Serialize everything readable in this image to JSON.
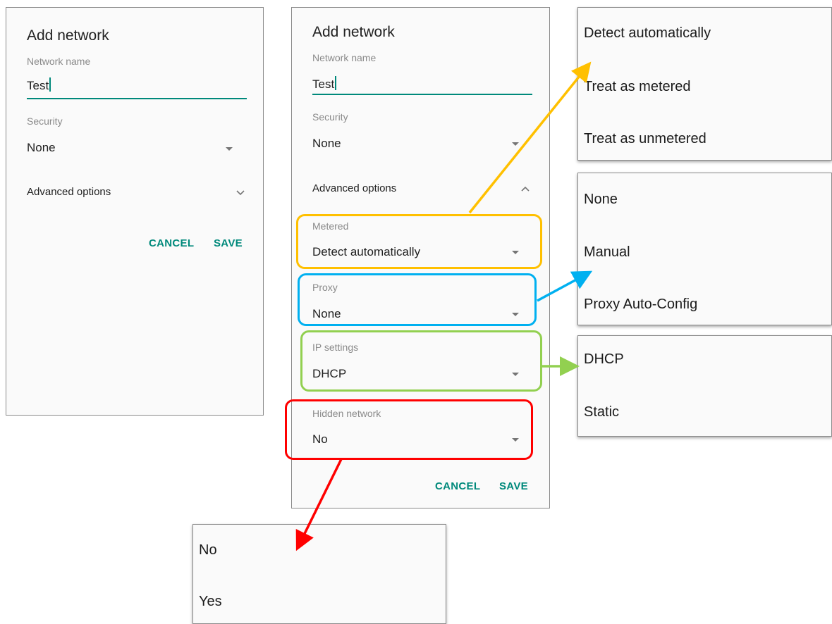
{
  "simple_dialog": {
    "title": "Add network",
    "network_name_label": "Network name",
    "network_name_value": "Test",
    "security_label": "Security",
    "security_value": "None",
    "advanced_label": "Advanced options",
    "cancel": "CANCEL",
    "save": "SAVE"
  },
  "advanced_dialog": {
    "title": "Add network",
    "network_name_label": "Network name",
    "network_name_value": "Test",
    "security_label": "Security",
    "security_value": "None",
    "advanced_label": "Advanced options",
    "metered_label": "Metered",
    "metered_value": "Detect automatically",
    "proxy_label": "Proxy",
    "proxy_value": "None",
    "ip_label": "IP settings",
    "ip_value": "DHCP",
    "hidden_label": "Hidden network",
    "hidden_value": "No",
    "cancel": "CANCEL",
    "save": "SAVE"
  },
  "metered_menu": [
    "Detect automatically",
    "Treat as metered",
    "Treat as unmetered"
  ],
  "proxy_menu": [
    "None",
    "Manual",
    "Proxy Auto-Config"
  ],
  "ip_menu": [
    "DHCP",
    "Static"
  ],
  "hidden_menu": [
    "No",
    "Yes"
  ],
  "colors": {
    "accent": "#00897b",
    "metered_highlight": "#ffc000",
    "proxy_highlight": "#00b0f0",
    "ip_highlight": "#92d050",
    "hidden_highlight": "#ff0000"
  }
}
